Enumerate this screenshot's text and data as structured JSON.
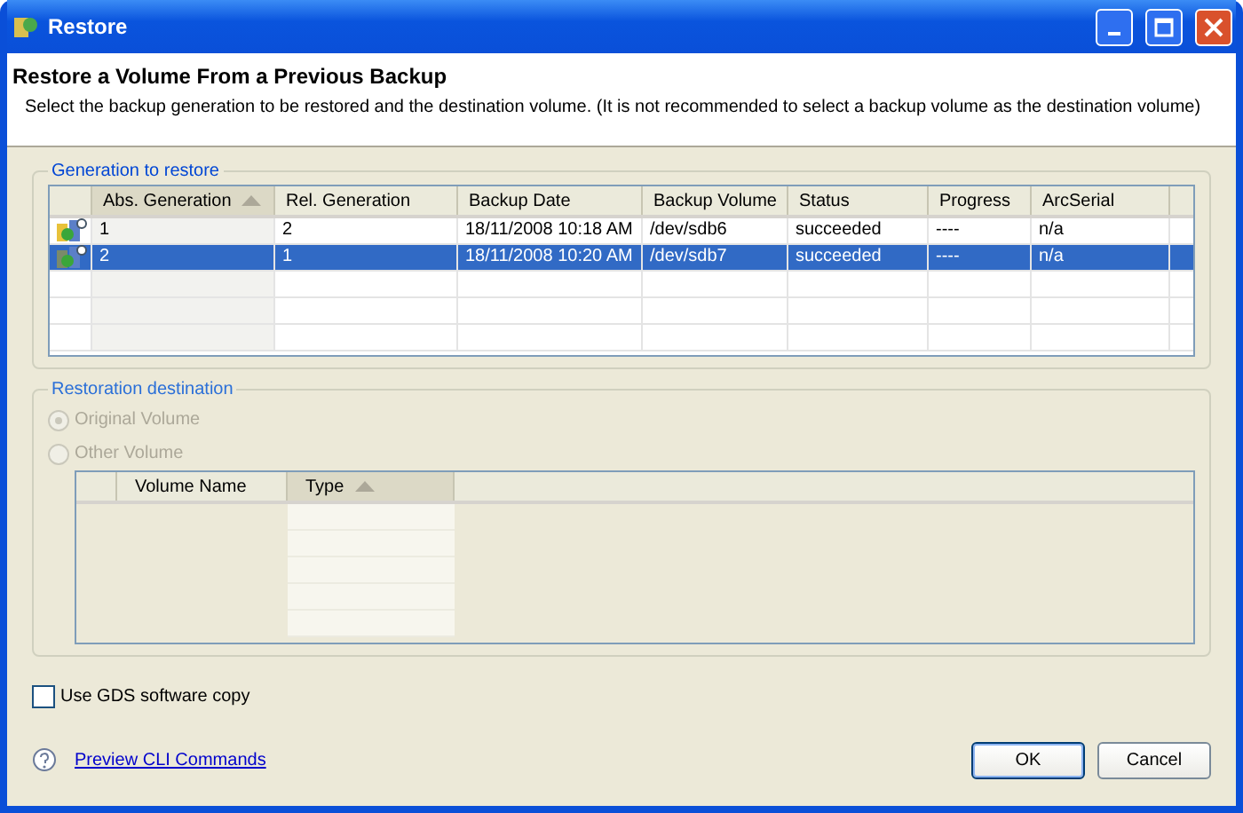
{
  "window": {
    "title": "Restore"
  },
  "header": {
    "title": "Restore a Volume From a Previous Backup",
    "description": "Select the backup generation to be restored and the destination volume. (It is not recommended to select a backup volume as the destination volume)"
  },
  "generation_group": {
    "title": "Generation to restore",
    "columns": [
      {
        "label": "Abs. Generation",
        "sorted": true
      },
      {
        "label": "Rel. Generation",
        "sorted": false
      },
      {
        "label": "Backup Date",
        "sorted": false
      },
      {
        "label": "Backup Volume",
        "sorted": false
      },
      {
        "label": "Status",
        "sorted": false
      },
      {
        "label": "Progress",
        "sorted": false
      },
      {
        "label": "ArcSerial",
        "sorted": false
      }
    ],
    "rows": [
      {
        "selected": false,
        "cells": [
          "1",
          "2",
          "18/11/2008 10:18 AM",
          "/dev/sdb6",
          "succeeded",
          "----",
          "n/a"
        ]
      },
      {
        "selected": true,
        "cells": [
          "2",
          "1",
          "18/11/2008 10:20 AM",
          "/dev/sdb7",
          "succeeded",
          "----",
          "n/a"
        ]
      }
    ]
  },
  "destination_group": {
    "title": "Restoration destination",
    "disabled": true,
    "options": [
      {
        "label": "Original Volume",
        "selected": true
      },
      {
        "label": "Other Volume",
        "selected": false
      }
    ],
    "columns": [
      {
        "label": "Volume Name",
        "sorted": false
      },
      {
        "label": "Type",
        "sorted": true
      }
    ]
  },
  "gds_copy": {
    "label": "Use GDS software copy",
    "checked": false
  },
  "footer": {
    "link": "Preview CLI Commands",
    "buttons": [
      "OK",
      "Cancel"
    ]
  }
}
